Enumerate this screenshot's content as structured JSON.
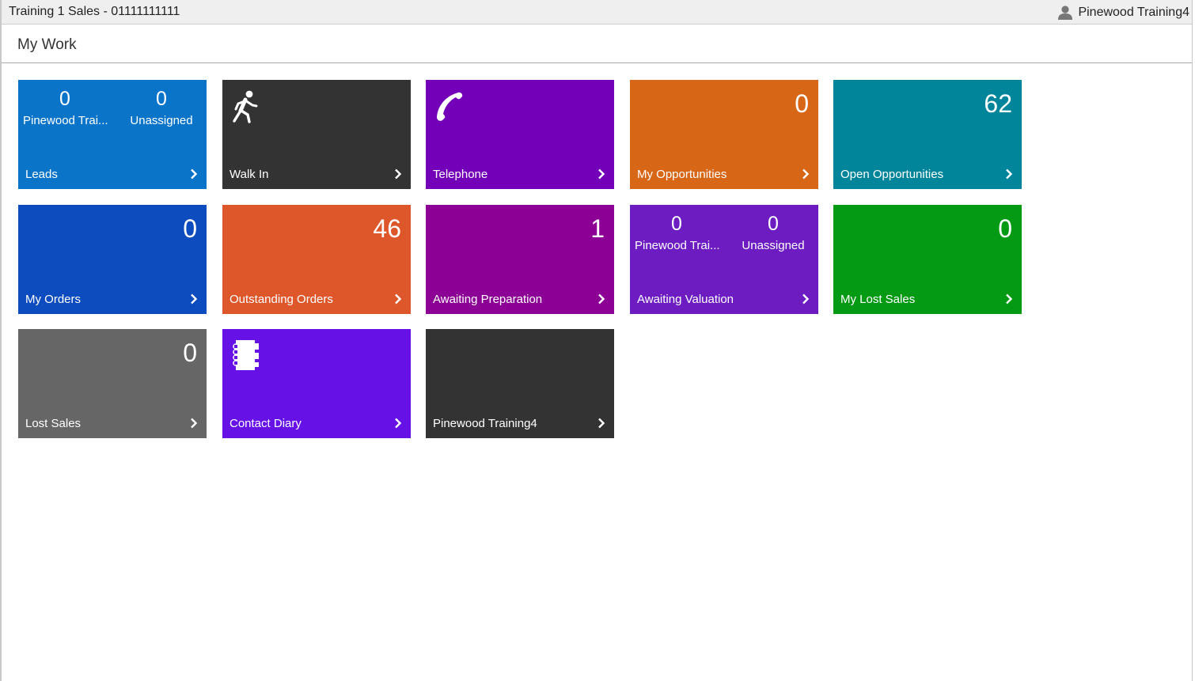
{
  "titlebar": {
    "title": "Training 1 Sales - 01111111111",
    "user": "Pinewood Training4",
    "user_icon": "user-icon"
  },
  "page": {
    "title": "My Work"
  },
  "colors": {
    "leads": "#0a74c9",
    "walk_in": "#333333",
    "telephone": "#7300b8",
    "my_opportunities": "#d86617",
    "open_opportunities": "#00859a",
    "my_orders": "#0d4cbf",
    "outstanding_orders": "#de572b",
    "awaiting_preparation": "#8c0096",
    "awaiting_valuation": "#6d1cc2",
    "my_lost_sales": "#059a14",
    "lost_sales": "#666666",
    "contact_diary": "#6612e6",
    "pinewood_training4": "#333333"
  },
  "tiles": {
    "leads": {
      "label": "Leads",
      "left_count": "0",
      "left_label": "Pinewood Trai...",
      "right_count": "0",
      "right_label": "Unassigned"
    },
    "walk_in": {
      "label": "Walk In",
      "icon": "walking-person-icon"
    },
    "telephone": {
      "label": "Telephone",
      "icon": "phone-handset-icon"
    },
    "my_opportunities": {
      "label": "My Opportunities",
      "count": "0"
    },
    "open_opportunities": {
      "label": "Open Opportunities",
      "count": "62"
    },
    "my_orders": {
      "label": "My Orders",
      "count": "0"
    },
    "outstanding_orders": {
      "label": "Outstanding Orders",
      "count": "46"
    },
    "awaiting_preparation": {
      "label": "Awaiting Preparation",
      "count": "1"
    },
    "awaiting_valuation": {
      "label": "Awaiting Valuation",
      "left_count": "0",
      "left_label": "Pinewood Trai...",
      "right_count": "0",
      "right_label": "Unassigned"
    },
    "my_lost_sales": {
      "label": "My Lost Sales",
      "count": "0"
    },
    "lost_sales": {
      "label": "Lost Sales",
      "count": "0"
    },
    "contact_diary": {
      "label": "Contact Diary",
      "icon": "notebook-icon"
    },
    "pinewood_training4": {
      "label": "Pinewood Training4"
    }
  }
}
